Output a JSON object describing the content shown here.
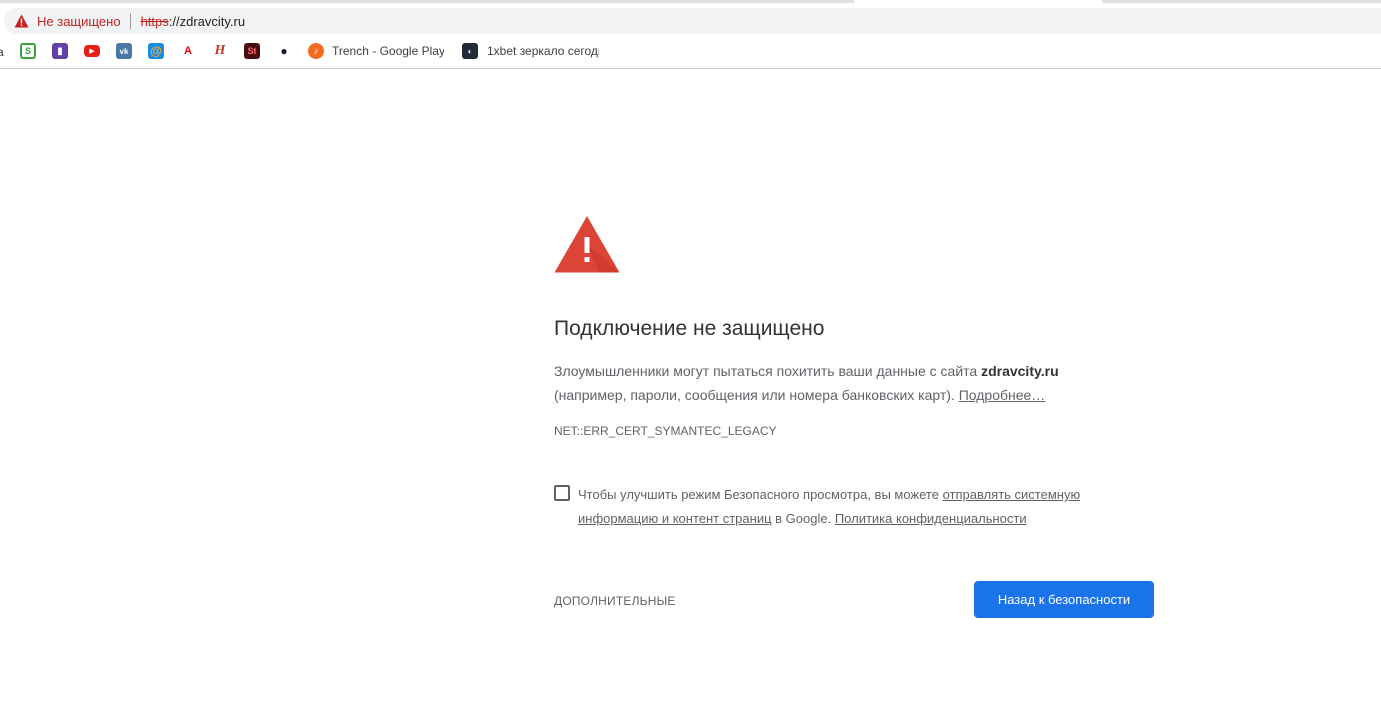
{
  "browser": {
    "security_label": "Не защищено",
    "url_scheme": "https",
    "url_rest": "://zdravcity.ru",
    "bookmarks": {
      "cut_text": "а",
      "trench_label": "Trench - Google Play",
      "xbet_label": "1xbet зеркало сегодн"
    }
  },
  "interstitial": {
    "heading": "Подключение не защищено",
    "desc_part1": "Злоумышленники могут пытаться похитить ваши данные с сайта ",
    "site": "zdravcity.ru",
    "desc_part2": " (например, пароли, сообщения или номера банковских карт). ",
    "learn_more": "Подробнее…",
    "error_code": "NET::ERR_CERT_SYMANTEC_LEGACY",
    "optin_part1": "Чтобы улучшить режим Безопасного просмотра, вы можете ",
    "optin_link1": "отправлять системную информацию и контент страниц",
    "optin_part2": " в Google. ",
    "optin_link2": "Политика конфиденциальности",
    "advanced": "ДОПОЛНИТЕЛЬНЫЕ",
    "back_button": "Назад к безопасности"
  },
  "colors": {
    "warning_red": "#db4437",
    "primary_blue": "#1a73e8",
    "not_secure_red": "#c5221f"
  }
}
